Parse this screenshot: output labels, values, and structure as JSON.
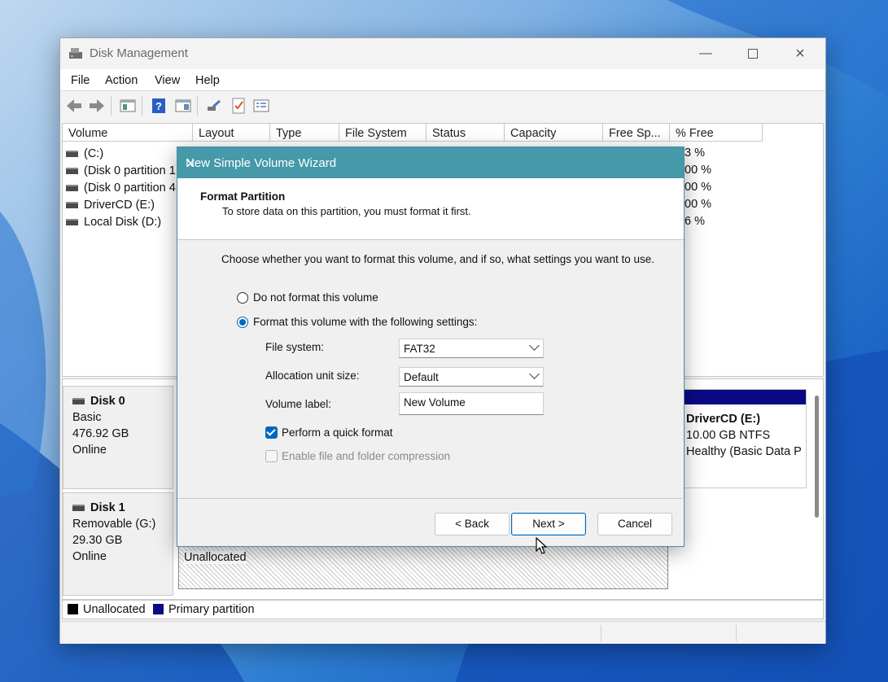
{
  "window": {
    "title": "Disk Management",
    "menu": [
      "File",
      "Action",
      "View",
      "Help"
    ]
  },
  "toolbar_icons": [
    "back-arrow-icon",
    "forward-arrow-icon",
    "console-tree-icon",
    "help-icon",
    "show-pane-icon",
    "connect-icon",
    "checklist-icon",
    "properties-icon"
  ],
  "columns": [
    "Volume",
    "Layout",
    "Type",
    "File System",
    "Status",
    "Capacity",
    "Free Sp...",
    "% Free"
  ],
  "volumes": [
    {
      "name": "(C:)",
      "pct_free": "3 %"
    },
    {
      "name": "(Disk 0 partition 1",
      "pct_free": "00 %"
    },
    {
      "name": "(Disk 0 partition 4",
      "pct_free": "00 %"
    },
    {
      "name": "DriverCD (E:)",
      "pct_free": "00 %"
    },
    {
      "name": "Local Disk (D:)",
      "pct_free": "6 %"
    }
  ],
  "disks": [
    {
      "name": "Disk 0",
      "type": "Basic",
      "size": "476.92 GB",
      "state": "Online"
    },
    {
      "name": "Disk 1",
      "type": "Removable (G:)",
      "size": "29.30 GB",
      "state": "Online"
    }
  ],
  "volume_e": {
    "name": "DriverCD  (E:)",
    "size": "10.00 GB NTFS",
    "status": "Healthy (Basic Data P"
  },
  "unallocated_label": "Unallocated",
  "legend": [
    {
      "label": "Unallocated",
      "color": "#000000"
    },
    {
      "label": "Primary partition",
      "color": "#0a0a84"
    }
  ],
  "dialog": {
    "title": "New Simple Volume Wizard",
    "heading": "Format Partition",
    "subheading": "To store data on this partition, you must format it first.",
    "intro": "Choose whether you want to format this volume, and if so, what settings you want to use.",
    "radio_no_format": "Do not format this volume",
    "radio_format": "Format this volume with the following settings:",
    "fs_label": "File system:",
    "fs_value": "FAT32",
    "alloc_label": "Allocation unit size:",
    "alloc_value": "Default",
    "vol_label_label": "Volume label:",
    "vol_label_value": "New Volume",
    "quick_format": "Perform a quick format",
    "compression": "Enable file and folder compression",
    "back": "< Back",
    "next": "Next >",
    "cancel": "Cancel"
  },
  "colors": {
    "dialog_title": "#4599a8",
    "accent": "#0067c0",
    "primary_partition": "#0a0a84"
  }
}
